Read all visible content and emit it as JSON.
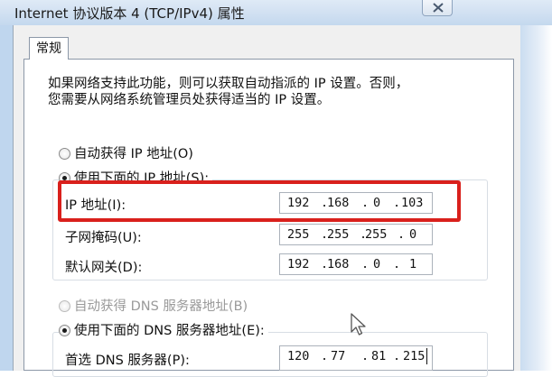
{
  "window": {
    "title": "Internet 协议版本 4 (TCP/IPv4) 属性",
    "tab_general": "常规"
  },
  "description": {
    "line1": "如果网络支持此功能，则可以获取自动指派的 IP 设置。否则，",
    "line2": "您需要从网络系统管理员处获得适当的 IP 设置。"
  },
  "ip_section": {
    "auto_label": "自动获得 IP 地址(O)",
    "manual_label": "使用下面的 IP 地址(S):",
    "ip_address_label": "IP 地址(I):",
    "subnet_mask_label": "子网掩码(U):",
    "gateway_label": "默认网关(D):",
    "ip_address": [
      "192",
      "168",
      "0",
      "103"
    ],
    "subnet_mask": [
      "255",
      "255",
      "255",
      "0"
    ],
    "gateway": [
      "192",
      "168",
      "0",
      "1"
    ],
    "selected": "manual"
  },
  "dns_section": {
    "auto_label": "自动获得 DNS 服务器地址(B)",
    "manual_label": "使用下面的 DNS 服务器地址(E):",
    "preferred_label": "首选 DNS 服务器(P):",
    "preferred_dns": [
      "120",
      "77",
      "81",
      "215"
    ],
    "selected": "manual"
  },
  "colors": {
    "highlight": "#d9201c",
    "frame": "#bfd6ee"
  }
}
